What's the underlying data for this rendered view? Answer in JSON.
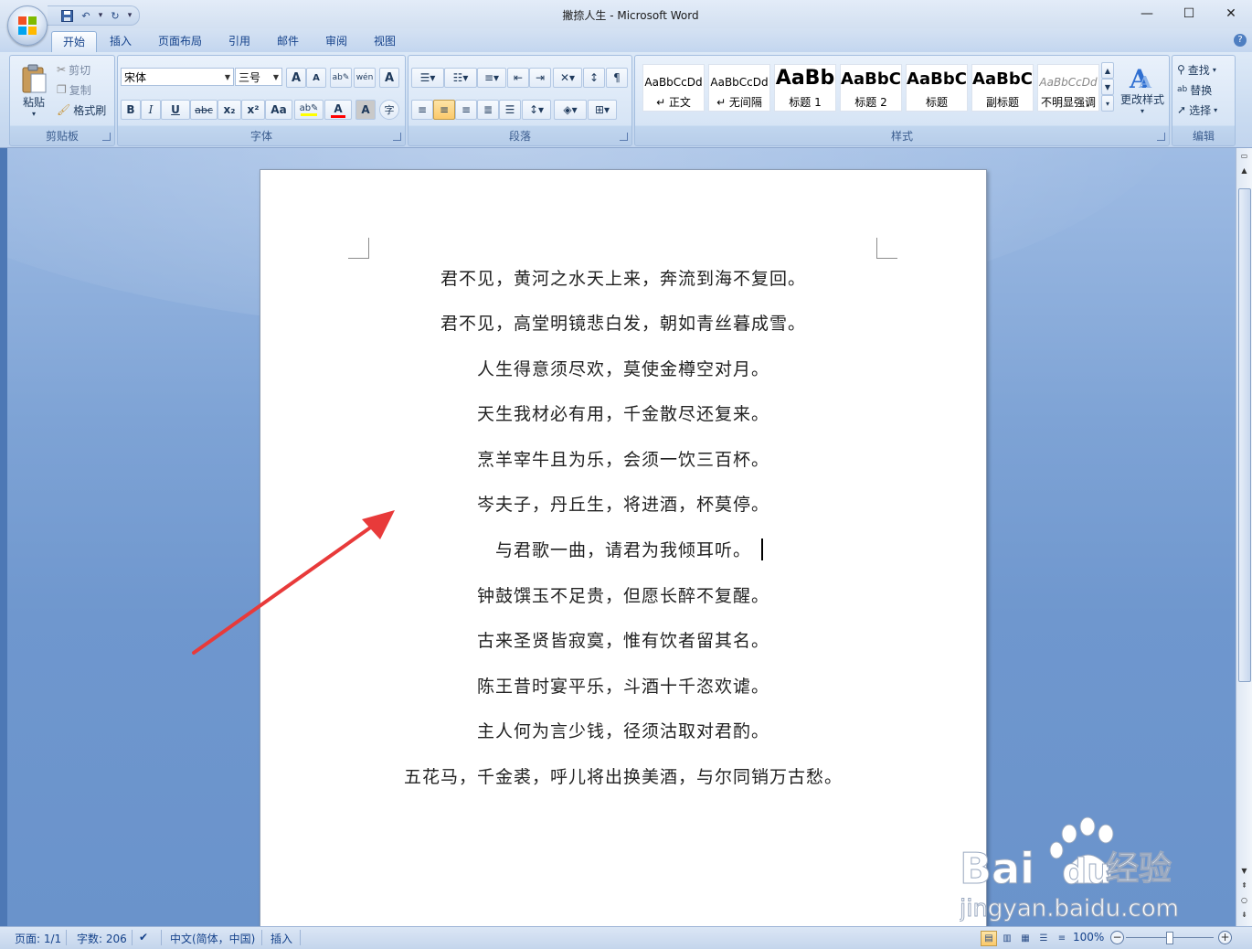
{
  "window": {
    "title": "撇捺人生 - Microsoft Word",
    "minimize": "—",
    "maximize": "☐",
    "close": "✕"
  },
  "tabs": [
    "开始",
    "插入",
    "页面布局",
    "引用",
    "邮件",
    "审阅",
    "视图"
  ],
  "active_tab": "开始",
  "clipboard": {
    "paste": "粘贴",
    "cut": "剪切",
    "copy": "复制",
    "format_painter": "格式刷",
    "group_label": "剪贴板"
  },
  "font": {
    "name": "宋体",
    "size": "三号",
    "group_label": "字体",
    "grow": "A",
    "shrink": "A",
    "bold": "B",
    "italic": "I",
    "underline": "U",
    "strike": "abc",
    "subscript": "x₂",
    "superscript": "x²",
    "change_case": "Aa",
    "font_color": "A",
    "char_shading": "A",
    "enclose": "字"
  },
  "paragraph": {
    "group_label": "段落"
  },
  "styles": {
    "group_label": "样式",
    "items": [
      {
        "sample": "AaBbCcDd",
        "name": "↵ 正文"
      },
      {
        "sample": "AaBbCcDd",
        "name": "↵ 无间隔"
      },
      {
        "sample": "AaBb",
        "name": "标题 1"
      },
      {
        "sample": "AaBbC",
        "name": "标题 2"
      },
      {
        "sample": "AaBbC",
        "name": "标题"
      },
      {
        "sample": "AaBbC",
        "name": "副标题"
      },
      {
        "sample": "AaBbCcDd",
        "name": "不明显强调"
      }
    ],
    "change_styles": "更改样式"
  },
  "editing": {
    "find": "查找",
    "replace": "替换",
    "select": "选择",
    "group_label": "编辑"
  },
  "document": {
    "lines": [
      "君不见，黄河之水天上来，奔流到海不复回。",
      "君不见，高堂明镜悲白发，朝如青丝暮成雪。",
      "人生得意须尽欢，莫使金樽空对月。",
      "天生我材必有用，千金散尽还复来。",
      "烹羊宰牛且为乐，会须一饮三百杯。",
      "岑夫子，丹丘生，将进酒，杯莫停。",
      "与君歌一曲，请君为我倾耳听。",
      "钟鼓馔玉不足贵，但愿长醉不复醒。",
      "古来圣贤皆寂寞，惟有饮者留其名。",
      "陈王昔时宴平乐，斗酒十千恣欢谑。",
      "主人何为言少钱，径须沽取对君酌。",
      "五花马，千金裘，呼儿将出换美酒，与尔同销万古愁。"
    ]
  },
  "status": {
    "page": "页面: 1/1",
    "words": "字数: 206",
    "language": "中文(简体，中国)",
    "mode": "插入",
    "zoom": "100%"
  },
  "watermark": {
    "brand": "Bai",
    "brand2": "du",
    "product": "经验",
    "url": "jingyan.baidu.com"
  },
  "colors": {
    "accent": "#15428b",
    "arrow": "#e83a3a",
    "font_color_bar": "#ff0000",
    "highlight_bar": "#ffff00"
  }
}
